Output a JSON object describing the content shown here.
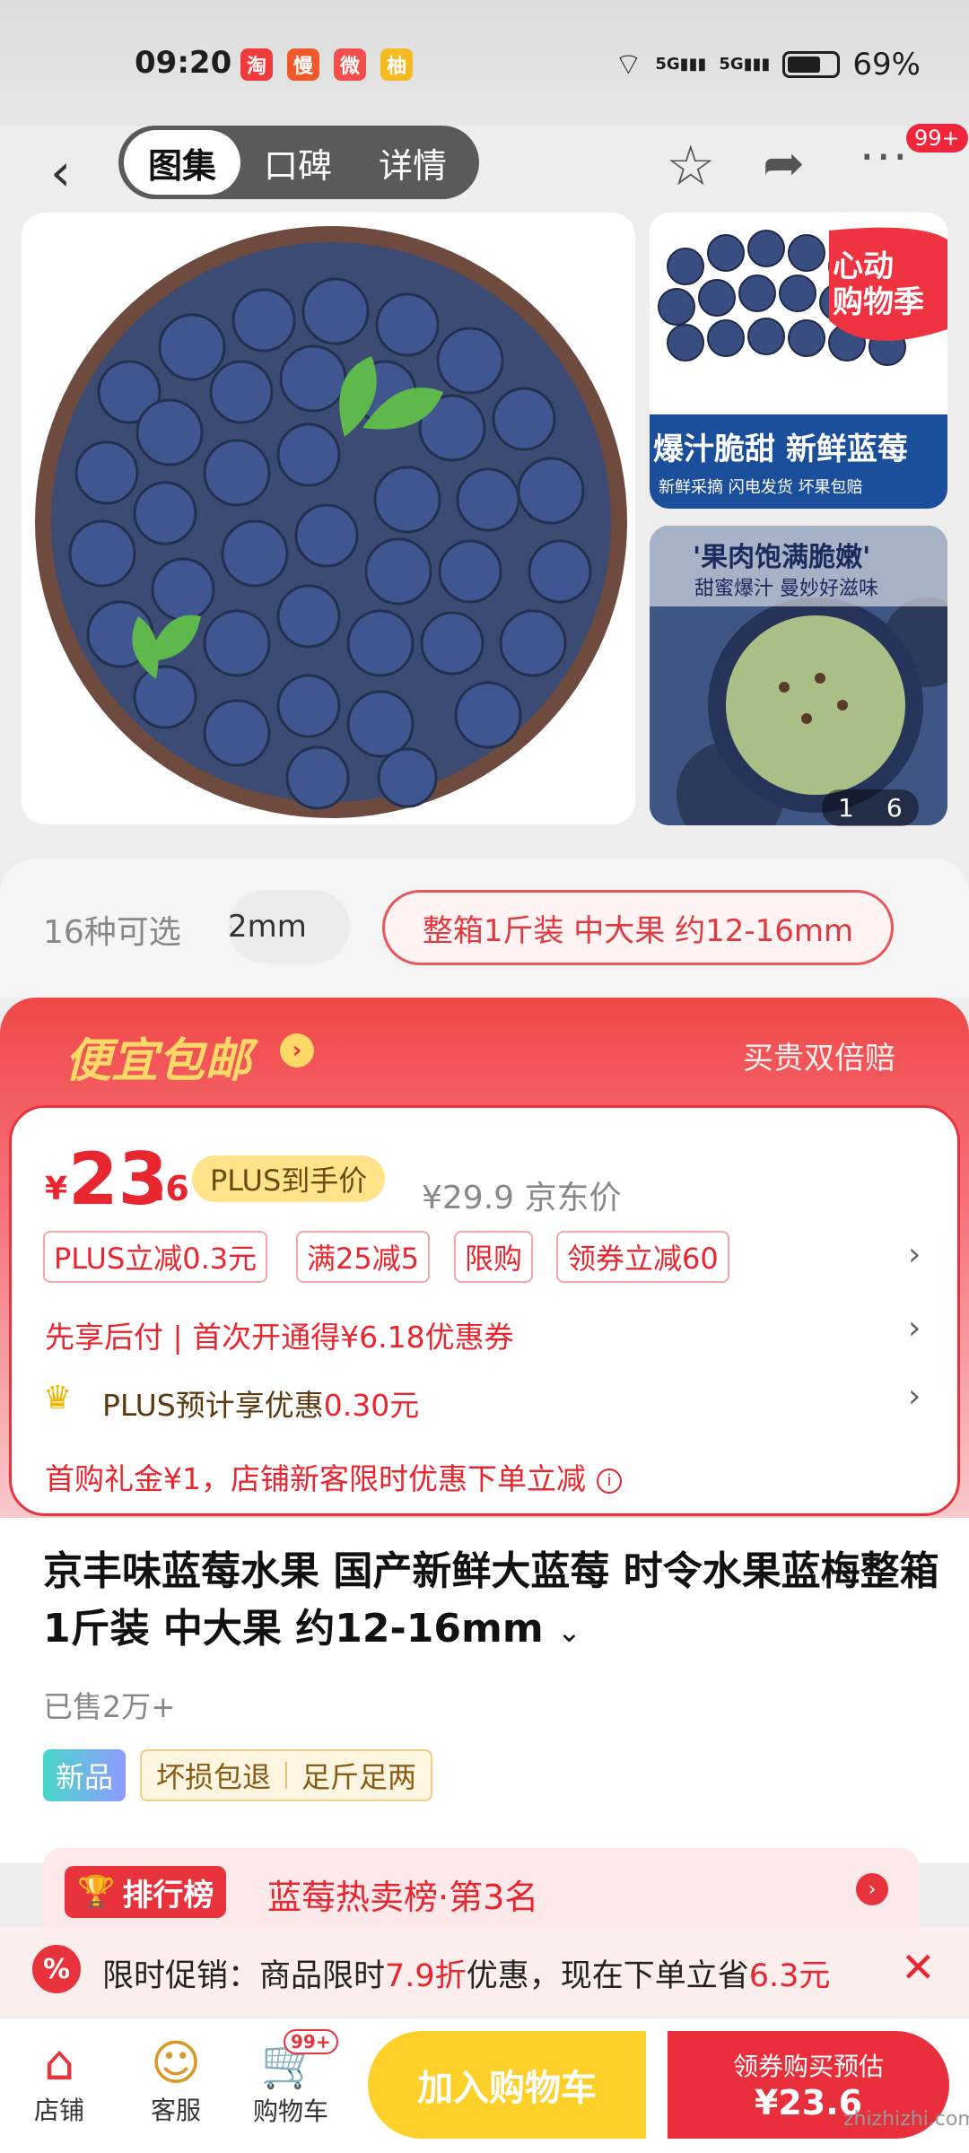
{
  "status_bar": {
    "time": "09:20",
    "apps": [
      "淘",
      "慢",
      "微",
      "柚"
    ],
    "network": "5G",
    "battery": "69%"
  },
  "nav": {
    "tabs": [
      "图集",
      "口碑",
      "详情"
    ],
    "active_tab": "图集",
    "more_badge": "99+"
  },
  "gallery": {
    "thumb1_ribbon": "心动\n购物季",
    "thumb1_banner": "爆汁脆甜 新鲜蓝莓",
    "thumb1_sub": "新鲜采摘 闪电发货 坏果包赔",
    "thumb2_title": "'果肉饱满脆嫩'",
    "thumb2_sub": "甜蜜爆汁 曼妙好滋味",
    "page_current": "1",
    "page_total": "6"
  },
  "spec": {
    "label": "16种可选",
    "option1": "2mm",
    "option2": "整箱1斤装 中大果 约12-16mm"
  },
  "promo": {
    "title": "便宜包邮",
    "right_text": "买贵双倍赔",
    "currency": "¥",
    "price_int": "23",
    "price_dec": ".6",
    "plus_tag": "PLUS到手价",
    "jd_price": "¥29.9 京东价",
    "coupons": [
      "PLUS立减0.3元",
      "满25减5",
      "限购",
      "领券立减60"
    ],
    "pay_later": "先享后付 | 首次开通得¥6.18优惠券",
    "plus_prefix": "PLUS预计享优惠",
    "plus_value": "0.30元",
    "gift": "首购礼金¥1，店铺新客限时优惠下单立减"
  },
  "product": {
    "title": "京丰味蓝莓水果 国产新鲜大蓝莓 时令水果蓝梅整箱1斤装 中大果 约12-16mm",
    "sold": "已售2万+",
    "tag_new": "新品",
    "tags": [
      "坏损包退",
      "足斤足两"
    ]
  },
  "ranking": {
    "badge": "排行榜",
    "text": "蓝莓热卖榜·第3名"
  },
  "toast": {
    "prefix": "限时促销：商品限时",
    "discount": "7.9折",
    "mid": "优惠，现在下单立省",
    "save": "6.3元"
  },
  "bottom": {
    "store": "店铺",
    "service": "客服",
    "cart": "购物车",
    "cart_badge": "99+",
    "add_cart": "加入购物车",
    "buy_top": "领券购买预估",
    "buy_price": "¥23.6"
  },
  "watermark": "zhizhizhi.com",
  "colors": {
    "accent": "#e8262f",
    "yellow": "#fdd02a",
    "promo_gold": "#ffd868"
  }
}
